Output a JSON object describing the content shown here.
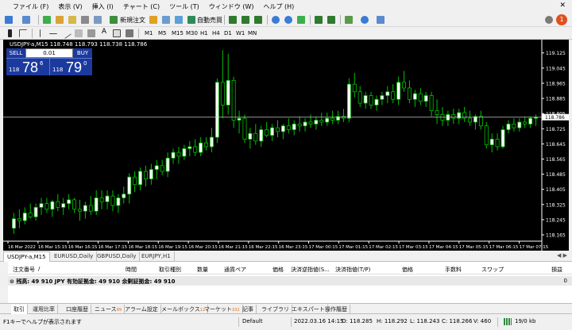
{
  "menu": [
    "ファイル (F)",
    "表示 (V)",
    "挿入 (I)",
    "チャート (C)",
    "ツール (T)",
    "ウィンドウ (W)",
    "ヘルプ (H)"
  ],
  "toolbar": {
    "new_order": "新規注文",
    "auto_trade": "自動売買",
    "timeframes": [
      "M1",
      "M5",
      "M15",
      "M30",
      "H1",
      "H4",
      "D1",
      "W1",
      "MN"
    ],
    "notification_badge": "1"
  },
  "chart": {
    "title": "USDJPY-a,M15  118.748 118.793 118.738 118.786",
    "trade_panel": {
      "sell_label": "SELL",
      "buy_label": "BUY",
      "lot": "0.01",
      "sell_prefix": "118",
      "sell_big": "78",
      "sell_sup": "6",
      "buy_prefix": "118",
      "buy_big": "79",
      "buy_sup": "0"
    },
    "current_price_label": "118.786",
    "colors": {
      "background": "#000000",
      "bull": "#ffffff",
      "bear": "#000000",
      "wick": "#00c000",
      "price_line": "#c8c8c8",
      "price_tag": "#ffffff"
    }
  },
  "chart_data": {
    "type": "candlestick",
    "symbol": "USDJPY-a",
    "timeframe": "M15",
    "y_ticks": [
      "119.125",
      "119.045",
      "118.965",
      "118.885",
      "118.805",
      "118.725",
      "118.645",
      "118.565",
      "118.485",
      "118.405",
      "118.325",
      "118.245",
      "118.165"
    ],
    "x_ticks": [
      "16 Mar 2022",
      "16 Mar 15:15",
      "16 Mar 16:15",
      "16 Mar 17:15",
      "16 Mar 18:15",
      "16 Mar 19:15",
      "16 Mar 20:15",
      "16 Mar 21:15",
      "16 Mar 22:15",
      "16 Mar 23:15",
      "17 Mar 00:15",
      "17 Mar 01:15",
      "17 Mar 02:15",
      "17 Mar 03:15",
      "17 Mar 04:15",
      "17 Mar 05:15",
      "17 Mar 06:15",
      "17 Mar 07:15"
    ],
    "ylim": [
      118.14,
      119.17
    ],
    "current_price": 118.786,
    "candles": [
      [
        118.2,
        118.28,
        118.17,
        118.25
      ],
      [
        118.25,
        118.3,
        118.2,
        118.24
      ],
      [
        118.24,
        118.31,
        118.22,
        118.28
      ],
      [
        118.28,
        118.33,
        118.25,
        118.26
      ],
      [
        118.26,
        118.33,
        118.24,
        118.31
      ],
      [
        118.31,
        118.36,
        118.27,
        118.33
      ],
      [
        118.33,
        118.36,
        118.28,
        118.3
      ],
      [
        118.3,
        118.35,
        118.26,
        118.34
      ],
      [
        118.34,
        118.38,
        118.29,
        118.31
      ],
      [
        118.31,
        118.36,
        118.27,
        118.33
      ],
      [
        118.33,
        118.38,
        118.3,
        118.35
      ],
      [
        118.35,
        118.36,
        118.28,
        118.3
      ],
      [
        118.3,
        118.35,
        118.24,
        118.29
      ],
      [
        118.29,
        118.34,
        118.25,
        118.32
      ],
      [
        118.32,
        118.37,
        118.27,
        118.29
      ],
      [
        118.29,
        118.4,
        118.27,
        118.36
      ],
      [
        118.36,
        118.4,
        118.3,
        118.34
      ],
      [
        118.34,
        118.4,
        118.3,
        118.37
      ],
      [
        118.37,
        118.4,
        118.29,
        118.32
      ],
      [
        118.32,
        118.38,
        118.28,
        118.36
      ],
      [
        118.36,
        118.42,
        118.33,
        118.38
      ],
      [
        118.38,
        118.49,
        118.33,
        118.47
      ],
      [
        118.47,
        118.5,
        118.39,
        118.43
      ],
      [
        118.43,
        118.52,
        118.4,
        118.5
      ],
      [
        118.5,
        118.53,
        118.42,
        118.46
      ],
      [
        118.46,
        118.54,
        118.43,
        118.51
      ],
      [
        118.51,
        118.56,
        118.46,
        118.53
      ],
      [
        118.53,
        118.56,
        118.48,
        118.5
      ],
      [
        118.5,
        118.6,
        118.47,
        118.57
      ],
      [
        118.57,
        118.62,
        118.54,
        118.6
      ],
      [
        118.6,
        118.63,
        118.54,
        118.58
      ],
      [
        118.58,
        118.64,
        118.56,
        118.62
      ],
      [
        118.62,
        118.66,
        118.58,
        118.63
      ],
      [
        118.63,
        118.67,
        118.58,
        118.6
      ],
      [
        118.6,
        118.68,
        118.58,
        118.65
      ],
      [
        118.65,
        118.68,
        118.61,
        118.63
      ],
      [
        118.63,
        118.73,
        118.6,
        118.68
      ],
      [
        118.68,
        118.99,
        118.65,
        118.97
      ],
      [
        118.97,
        119.14,
        118.78,
        118.85
      ],
      [
        118.85,
        119.12,
        118.8,
        118.98
      ],
      [
        118.98,
        119.0,
        118.73,
        118.77
      ],
      [
        118.77,
        118.82,
        118.7,
        118.78
      ],
      [
        118.78,
        118.8,
        118.65,
        118.67
      ],
      [
        118.67,
        118.73,
        118.62,
        118.7
      ],
      [
        118.7,
        118.75,
        118.64,
        118.66
      ],
      [
        118.66,
        118.74,
        118.63,
        118.72
      ],
      [
        118.72,
        118.76,
        118.68,
        118.69
      ],
      [
        118.69,
        118.75,
        118.66,
        118.73
      ],
      [
        118.73,
        118.77,
        118.68,
        118.71
      ],
      [
        118.71,
        118.75,
        118.67,
        118.74
      ],
      [
        118.74,
        118.78,
        118.7,
        118.72
      ],
      [
        118.72,
        118.77,
        118.69,
        118.75
      ],
      [
        118.75,
        118.79,
        118.71,
        118.74
      ],
      [
        118.74,
        118.78,
        118.71,
        118.76
      ],
      [
        118.76,
        118.8,
        118.73,
        118.75
      ],
      [
        118.75,
        118.79,
        118.72,
        118.77
      ],
      [
        118.77,
        118.81,
        118.74,
        118.76
      ],
      [
        118.76,
        118.81,
        118.74,
        118.78
      ],
      [
        118.78,
        118.82,
        118.75,
        118.77
      ],
      [
        118.77,
        118.82,
        118.75,
        118.79
      ],
      [
        118.79,
        118.83,
        118.76,
        118.78
      ],
      [
        118.78,
        118.99,
        118.76,
        118.96
      ],
      [
        118.96,
        119.02,
        118.89,
        118.92
      ],
      [
        118.92,
        118.95,
        118.84,
        118.86
      ],
      [
        118.86,
        118.92,
        118.83,
        118.9
      ],
      [
        118.9,
        118.92,
        118.83,
        118.85
      ],
      [
        118.85,
        118.9,
        118.82,
        118.88
      ],
      [
        118.88,
        118.92,
        118.85,
        118.9
      ],
      [
        118.9,
        118.95,
        118.86,
        118.92
      ],
      [
        118.92,
        118.96,
        118.86,
        118.88
      ],
      [
        118.88,
        119.0,
        118.85,
        118.97
      ],
      [
        118.97,
        119.03,
        118.92,
        118.94
      ],
      [
        118.94,
        118.98,
        118.86,
        118.88
      ],
      [
        118.88,
        118.93,
        118.84,
        118.91
      ],
      [
        118.91,
        118.94,
        118.85,
        118.87
      ],
      [
        118.87,
        118.92,
        118.84,
        118.9
      ],
      [
        118.9,
        118.92,
        118.79,
        118.82
      ],
      [
        118.82,
        118.88,
        118.75,
        118.8
      ],
      [
        118.8,
        118.84,
        118.74,
        118.77
      ],
      [
        118.77,
        118.82,
        118.74,
        118.8
      ],
      [
        118.8,
        118.83,
        118.75,
        118.78
      ],
      [
        118.78,
        118.83,
        118.75,
        118.81
      ],
      [
        118.81,
        118.84,
        118.76,
        118.78
      ],
      [
        118.78,
        118.82,
        118.74,
        118.76
      ],
      [
        118.76,
        118.8,
        118.72,
        118.79
      ],
      [
        118.79,
        118.82,
        118.72,
        118.74
      ],
      [
        118.74,
        118.76,
        118.62,
        118.64
      ],
      [
        118.64,
        118.7,
        118.6,
        118.67
      ],
      [
        118.67,
        118.7,
        118.61,
        118.63
      ],
      [
        118.63,
        118.74,
        118.62,
        118.72
      ],
      [
        118.72,
        118.77,
        118.7,
        118.75
      ],
      [
        118.75,
        118.78,
        118.71,
        118.73
      ],
      [
        118.73,
        118.78,
        118.71,
        118.76
      ],
      [
        118.76,
        118.79,
        118.73,
        118.75
      ],
      [
        118.75,
        118.79,
        118.73,
        118.78
      ],
      [
        118.78,
        118.8,
        118.74,
        118.786
      ]
    ]
  },
  "chart_tabs": [
    "USDJPY-a,M15",
    "EURUSD,Daily",
    "GBPUSD,Daily",
    "EURJPY,H1"
  ],
  "terminal": {
    "headers": {
      "order": "注文番号",
      "sort": "/",
      "time": "時間",
      "type": "取引種別",
      "qty": "数量",
      "pair": "通貨ペア",
      "price": "価格",
      "sl": "決済逆指値(S...",
      "tp": "決済指値(T/P)",
      "price2": "価格",
      "commission": "手数料",
      "swap": "スワップ",
      "profit": "損益"
    },
    "balance_row": "残高: 49 910 JPY  有効証拠金: 49 910  余剰証拠金: 49 910",
    "balance_value": "0"
  },
  "terminal_tabs": [
    {
      "label": "取引",
      "count": ""
    },
    {
      "label": "運用比率",
      "count": ""
    },
    {
      "label": "口座履歴",
      "count": ""
    },
    {
      "label": "ニュース",
      "count": "99"
    },
    {
      "label": "アラーム設定",
      "count": ""
    },
    {
      "label": "メールボックス",
      "count": "12"
    },
    {
      "label": "マーケット",
      "count": "102"
    },
    {
      "label": "記事",
      "count": ""
    },
    {
      "label": "ライブラリ",
      "count": ""
    },
    {
      "label": "エキスパート",
      "count": ""
    },
    {
      "label": "操作履歴",
      "count": ""
    }
  ],
  "status": {
    "help": "F1キーでヘルプが表示されます",
    "profile": "Default",
    "time": "2022.03.16 14:15",
    "open": "O: 118.285",
    "high": "H: 118.292",
    "low": "L: 118.243",
    "close": "C: 118.266",
    "volume": "V: 460",
    "traffic": "19/0 kb"
  }
}
